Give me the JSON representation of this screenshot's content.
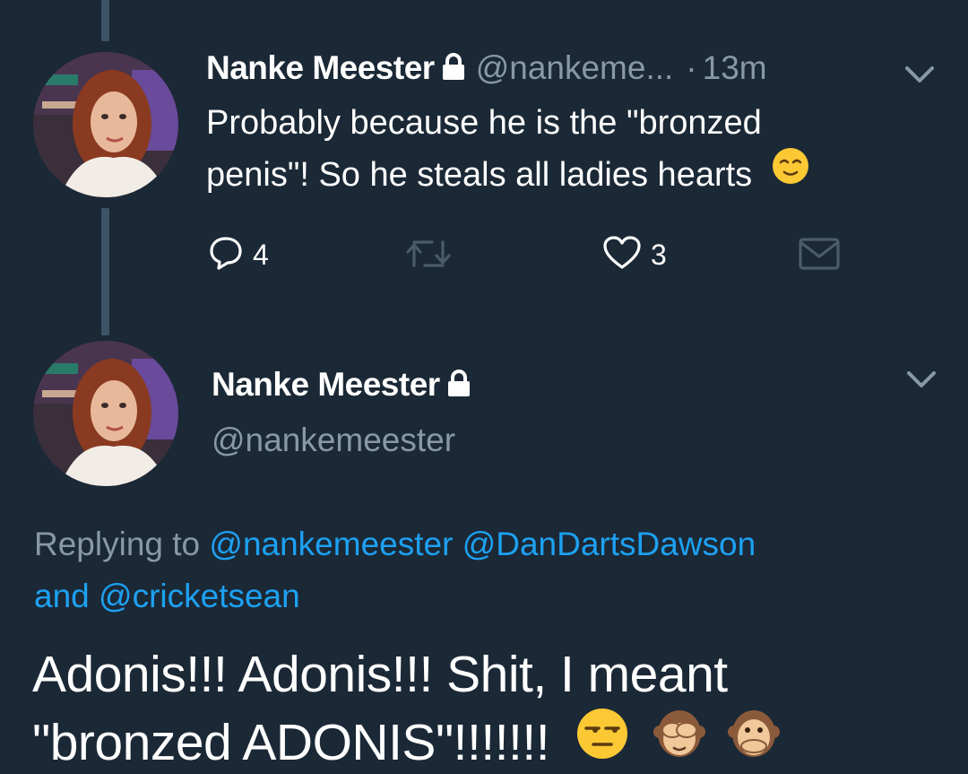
{
  "tweet1": {
    "display_name": "Nanke Meester",
    "handle": "@nankeme...",
    "dot": "·",
    "time": "13m",
    "text_line1": "Probably because he is the \"bronzed",
    "text_line2": "penis\"! So he steals all ladies hearts",
    "reply_count": "4",
    "like_count": "3"
  },
  "tweet2": {
    "display_name": "Nanke Meester",
    "handle": "@nankemeester",
    "replying_prefix": "Replying to",
    "mention1": "@nankemeester",
    "mention2": "@DanDartsDawson",
    "and_text": "and",
    "mention3": "@cricketsean",
    "text_line1": "Adonis!!! Adonis!!! Shit, I meant",
    "text_line2": "\"bronzed ADONIS\"!!!!!!!"
  },
  "colors": {
    "background": "#1b2836",
    "text": "#ffffff",
    "secondary": "#8899a6",
    "link": "#1da1f2",
    "thread_line": "#3d5466"
  },
  "icons": [
    "lock-icon",
    "chevron-down-icon",
    "reply-icon",
    "retweet-icon",
    "heart-icon",
    "dm-icon",
    "relieved-face-emoji",
    "unamused-face-emoji",
    "see-no-evil-monkey-emoji",
    "speak-no-evil-monkey-emoji"
  ]
}
